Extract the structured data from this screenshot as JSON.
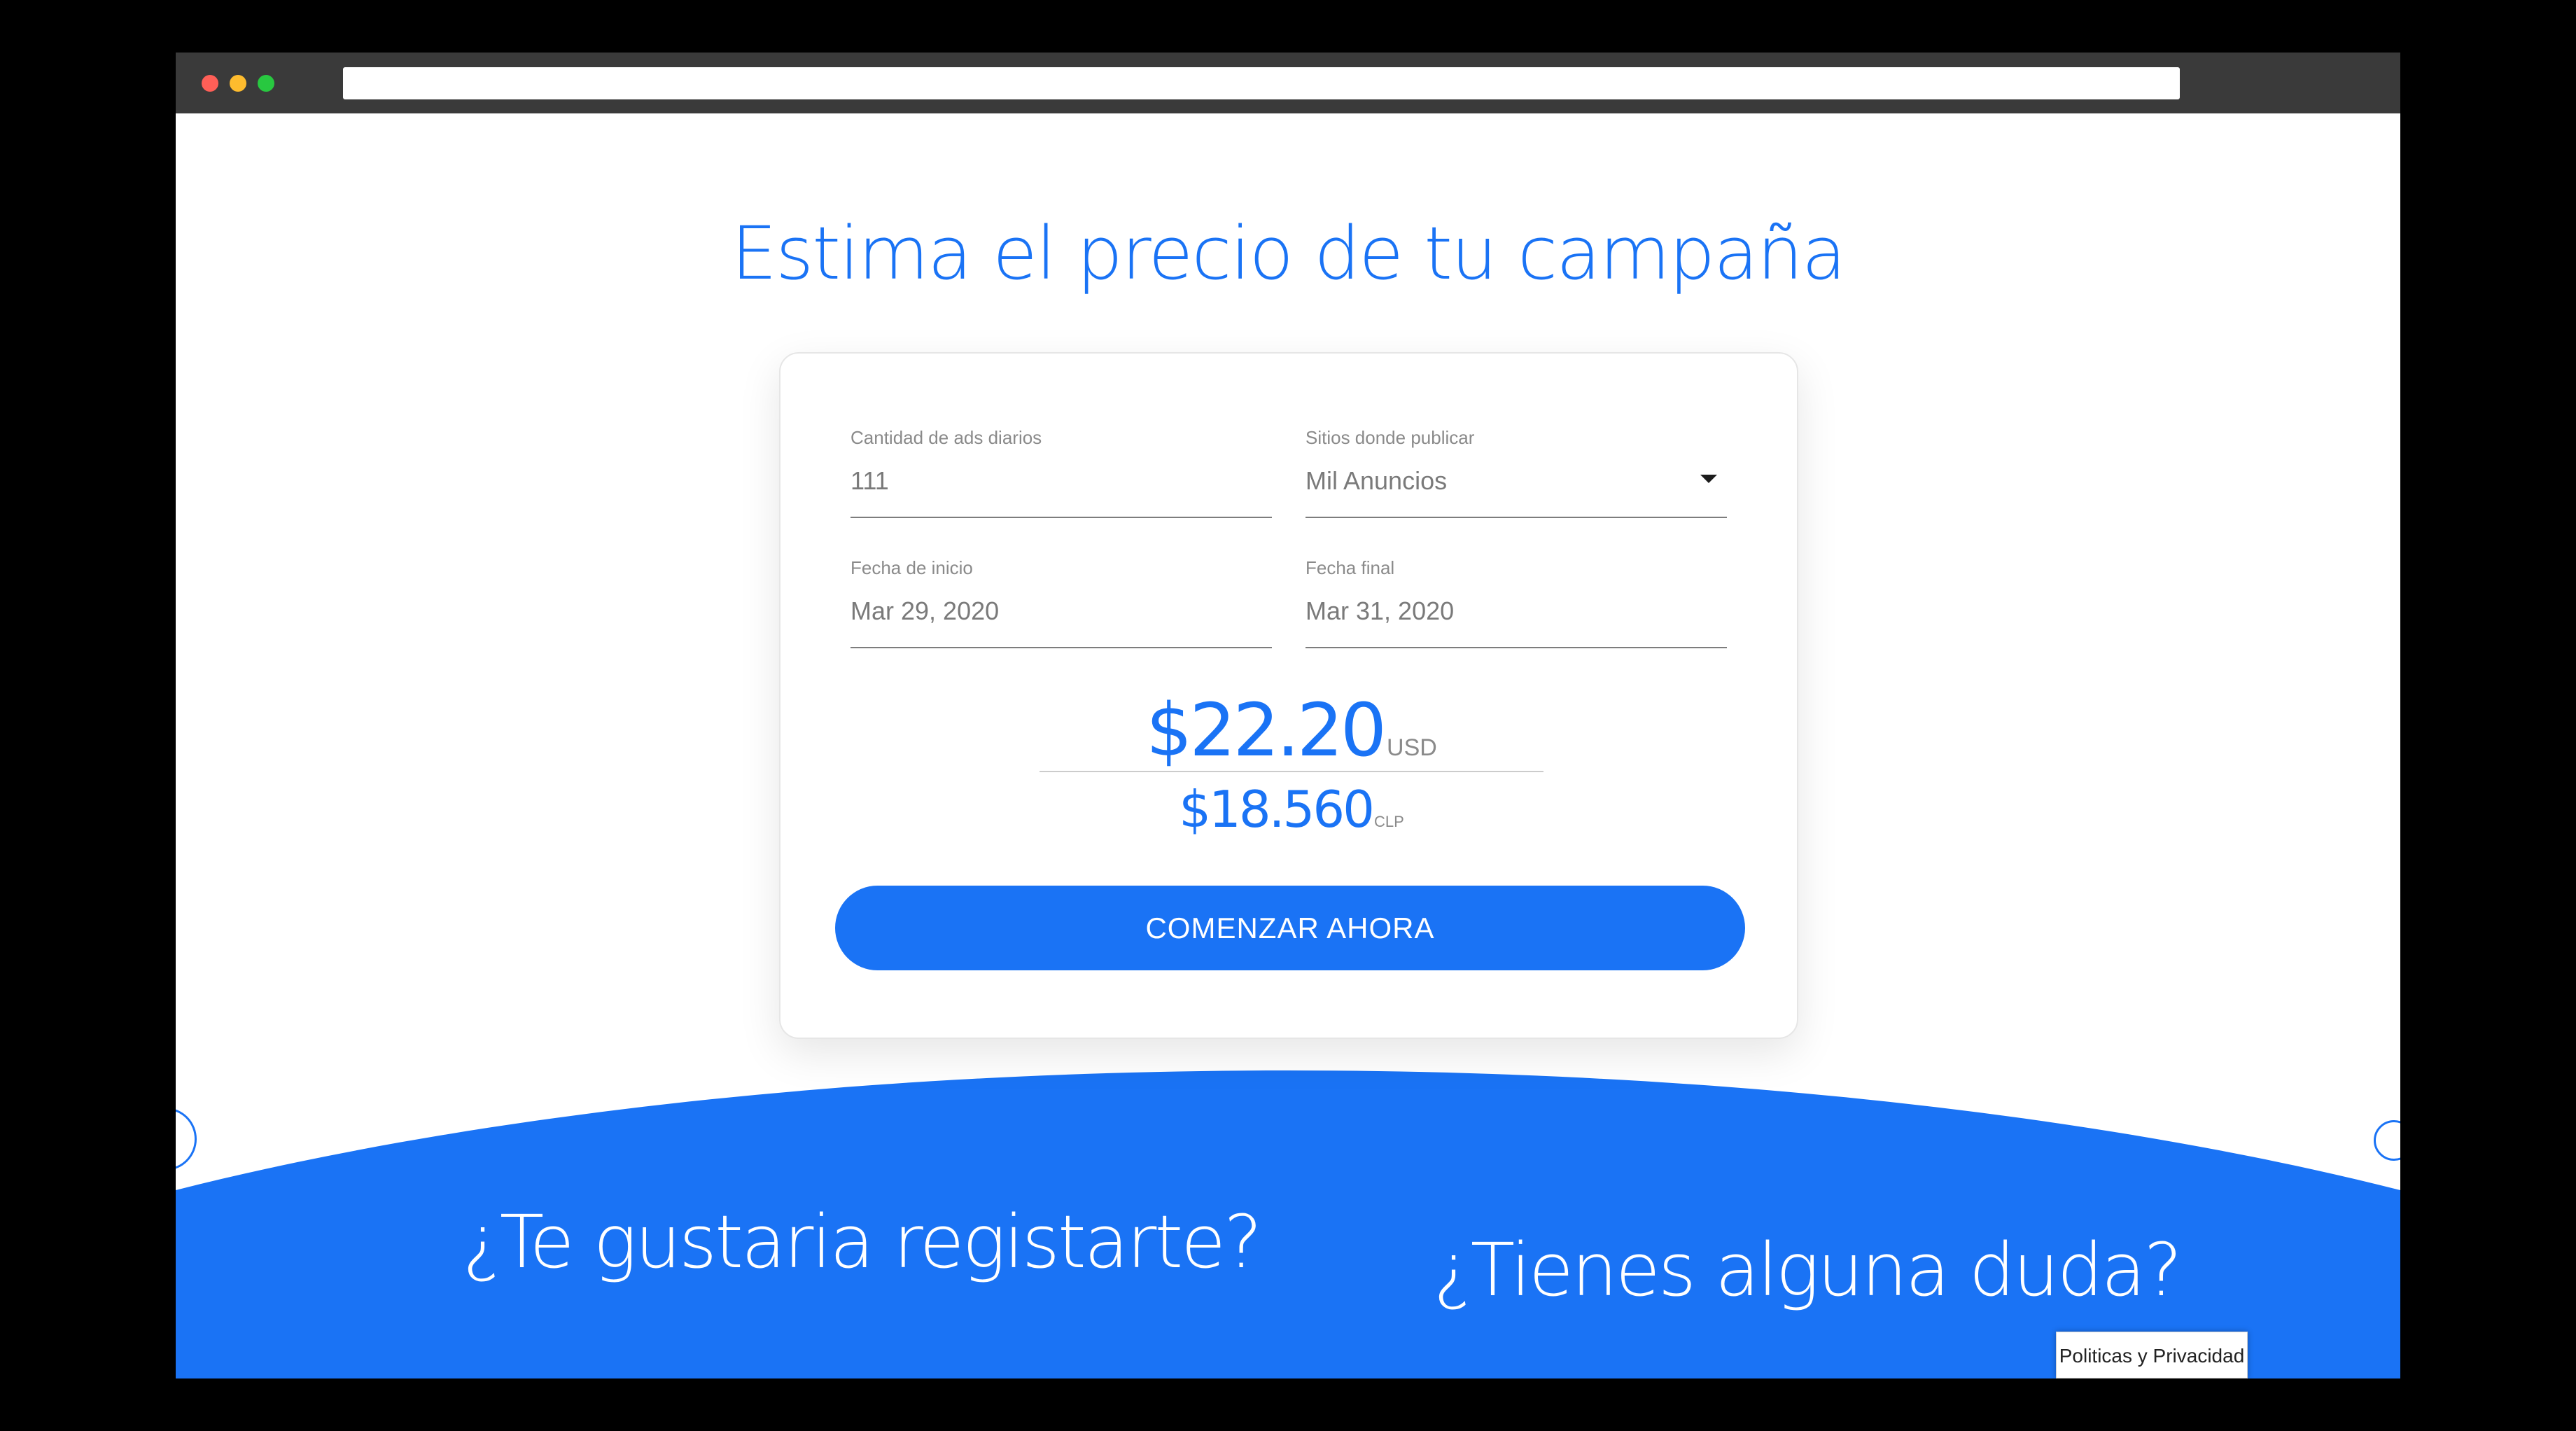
{
  "colors": {
    "accent": "#1a73f5",
    "background": "#ffffff",
    "frame": "#000000",
    "titlebar": "#3a3a3a"
  },
  "page": {
    "title": "Estima el precio de tu campaña"
  },
  "form": {
    "daily_ads": {
      "label": "Cantidad de ads diarios",
      "value": "111"
    },
    "sites": {
      "label": "Sitios donde publicar",
      "value": "Mil Anuncios",
      "icon": "caret-down-icon"
    },
    "start_date": {
      "label": "Fecha de inicio",
      "value": "Mar 29, 2020"
    },
    "end_date": {
      "label": "Fecha final",
      "value": "Mar 31, 2020"
    }
  },
  "price": {
    "usd_amount": "$22.20",
    "usd_currency": "USD",
    "clp_amount": "$18.560",
    "clp_currency": "CLP"
  },
  "cta": {
    "label": "COMENZAR AHORA"
  },
  "bottom": {
    "register_heading": "¿Te gustaria registarte?",
    "doubt_heading": "¿Tienes alguna duda?"
  },
  "privacy": {
    "label": "Politicas y Privacidad"
  }
}
